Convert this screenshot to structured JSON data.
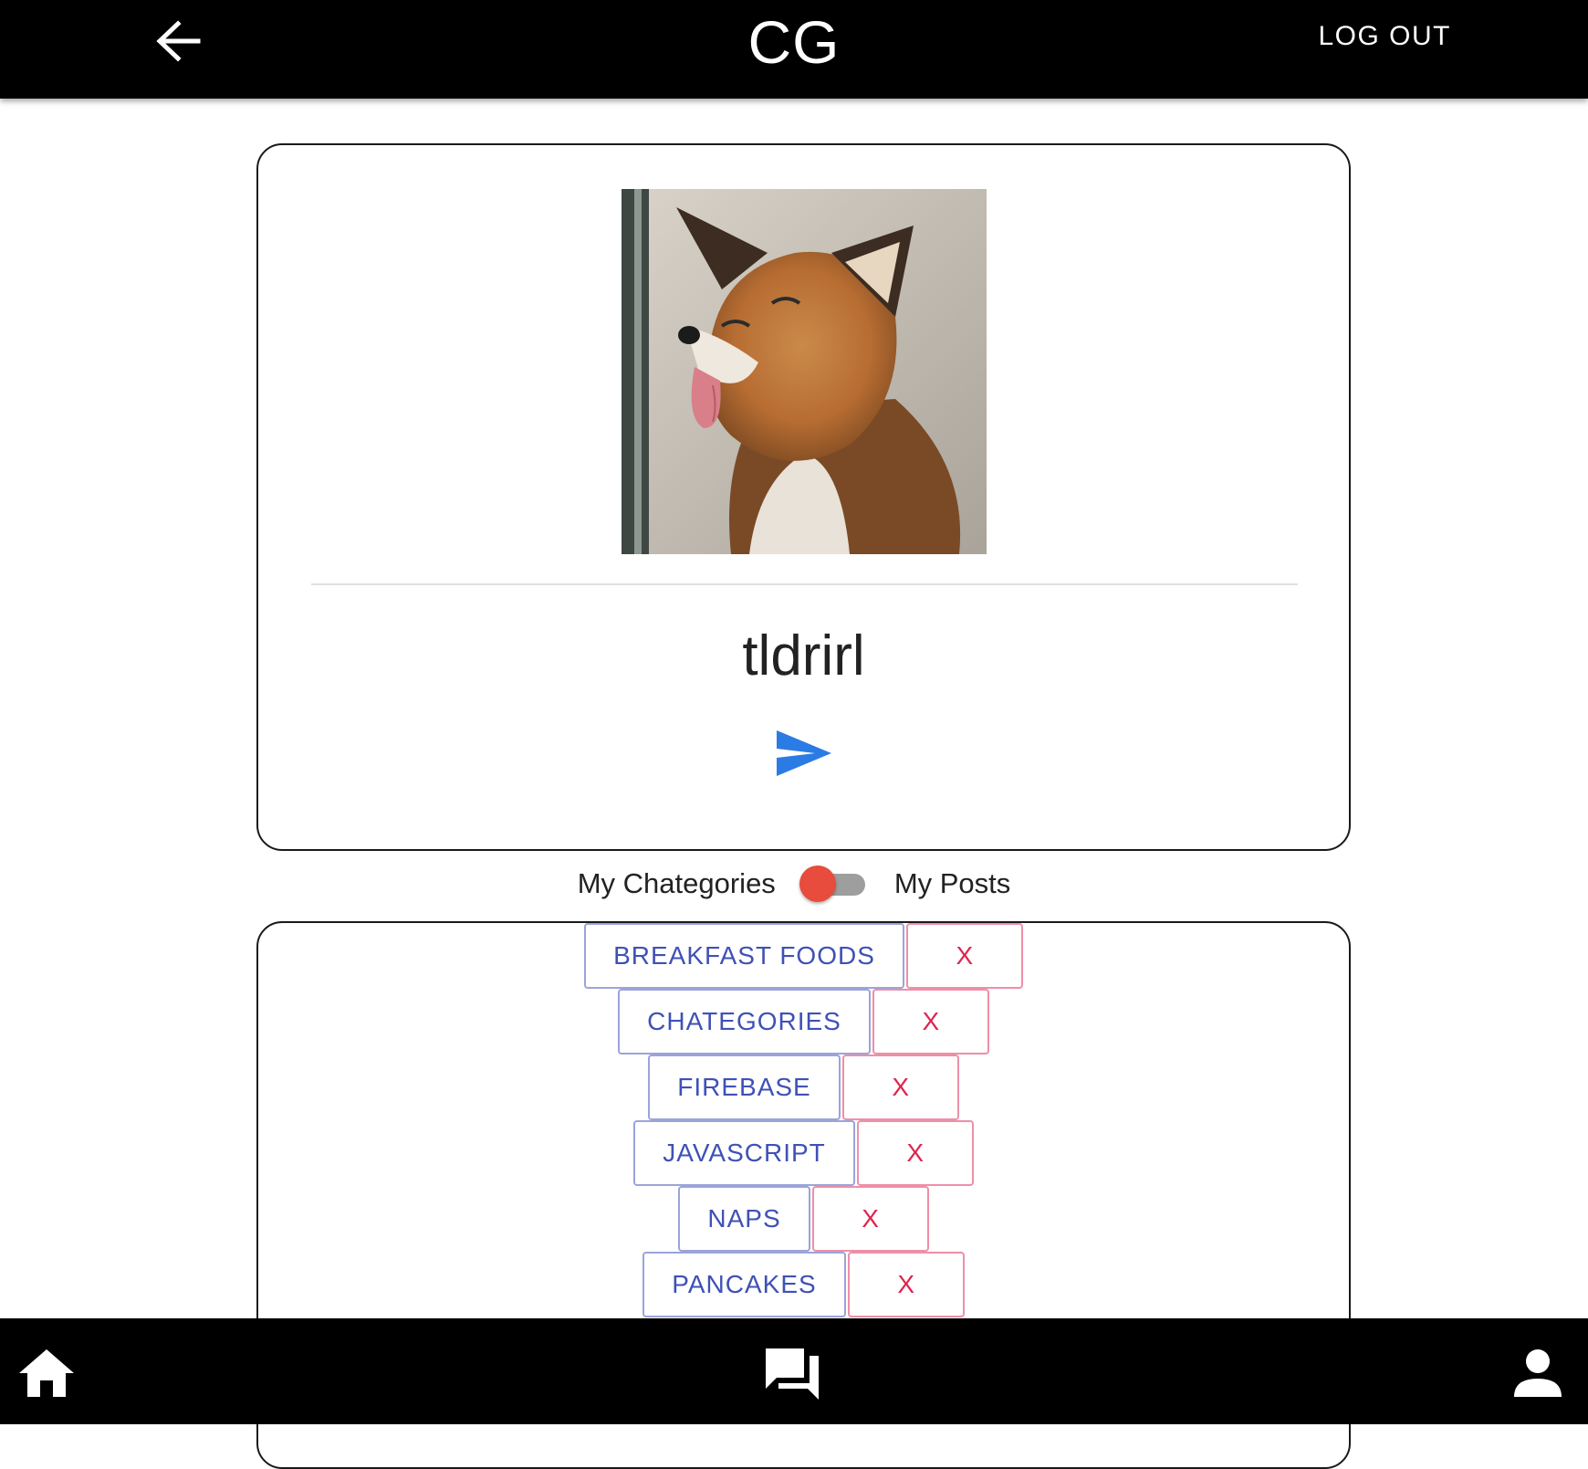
{
  "header": {
    "title": "CG",
    "back_icon": "arrow-left-icon",
    "logout_label": "LOG OUT"
  },
  "profile": {
    "avatar_alt": "fox",
    "username": "tldrirl",
    "send_icon": "send-icon"
  },
  "toggle": {
    "left_label": "My Chategories",
    "right_label": "My Posts",
    "state": "off",
    "thumb_color": "#e74c3c"
  },
  "categories": [
    {
      "name": "BREAKFAST FOODS",
      "delete_label": "X"
    },
    {
      "name": "CHATEGORIES",
      "delete_label": "X"
    },
    {
      "name": "FIREBASE",
      "delete_label": "X"
    },
    {
      "name": "JAVASCRIPT",
      "delete_label": "X"
    },
    {
      "name": "NAPS",
      "delete_label": "X"
    },
    {
      "name": "PANCAKES",
      "delete_label": "X"
    }
  ],
  "bottom_nav": {
    "items": [
      {
        "icon": "home-icon"
      },
      {
        "icon": "chat-icon"
      },
      {
        "icon": "person-icon"
      }
    ]
  },
  "colors": {
    "bar": "#000000",
    "category_text": "#3f51b5",
    "delete_text": "#e0244f",
    "send": "#2b7be4"
  }
}
